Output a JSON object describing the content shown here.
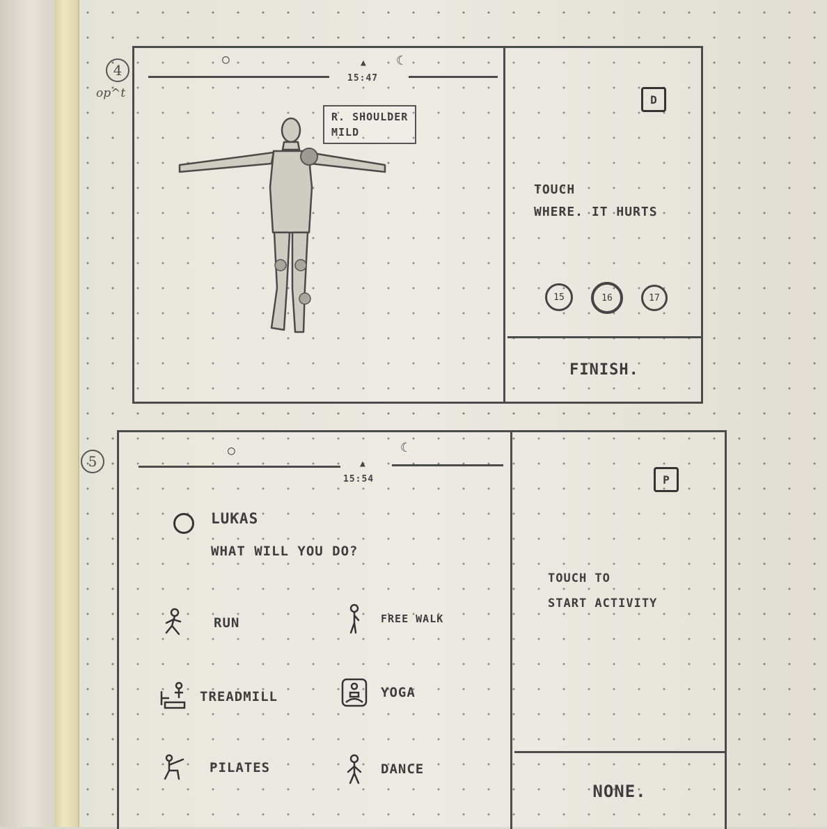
{
  "margin_note": "op^t",
  "screen4": {
    "number": "4",
    "time": "15:47",
    "pain_tag": {
      "location": "R. SHOULDER",
      "severity": "MILD"
    },
    "profile_badge": "D",
    "prompt": [
      "TOUCH",
      "WHERE. IT HURTS"
    ],
    "days": [
      "15",
      "16",
      "17"
    ],
    "selected_day": "16",
    "action": "FINISH."
  },
  "screen5": {
    "number": "5",
    "time": "15:54",
    "user": "LUKAS",
    "question": "WHAT WILL YOU DO?",
    "activities": [
      {
        "label": "RUN",
        "icon": "run-icon"
      },
      {
        "label": "FREE WALK",
        "icon": "walk-icon"
      },
      {
        "label": "TREADMILL",
        "icon": "treadmill-icon"
      },
      {
        "label": "YOGA",
        "icon": "yoga-icon"
      },
      {
        "label": "PILATES",
        "icon": "pilates-icon"
      },
      {
        "label": "DANCE",
        "icon": "dance-icon"
      }
    ],
    "profile_badge": "P",
    "prompt": [
      "TOUCH TO",
      "START ACTIVITY"
    ],
    "action": "NONE."
  }
}
